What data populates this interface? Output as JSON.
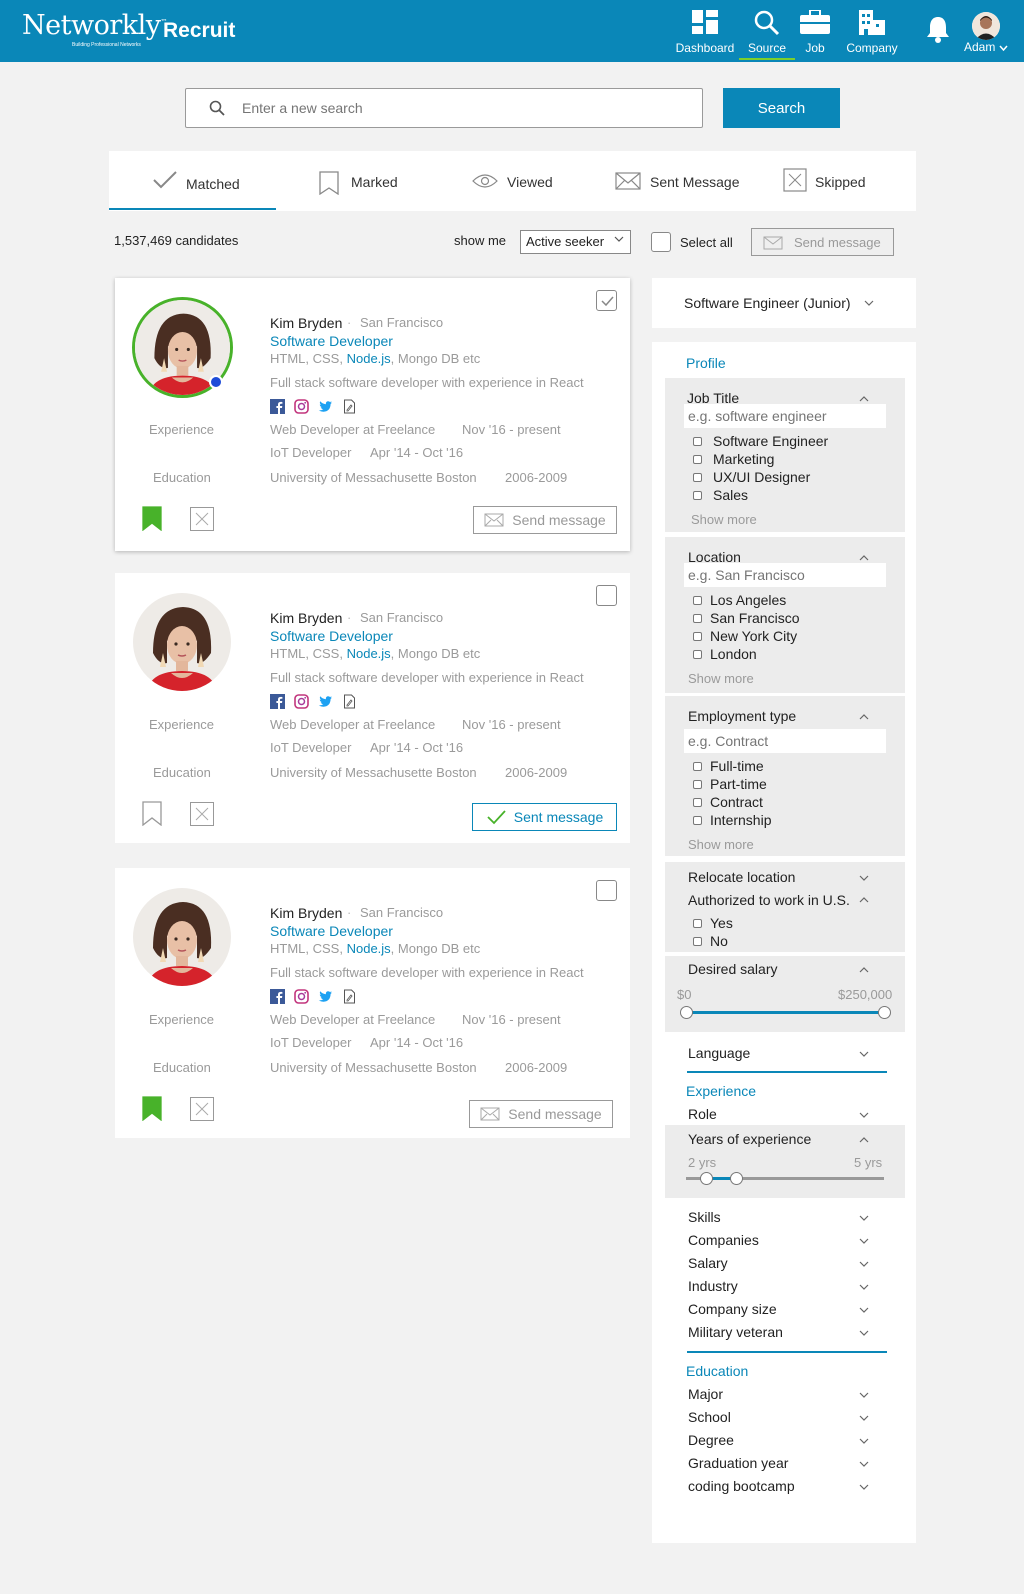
{
  "header": {
    "logo": "Networkly",
    "tm": "™",
    "tagline": "Building Professional Networks",
    "app": "Recruit",
    "nav": [
      "Dashboard",
      "Source",
      "Job",
      "Company"
    ],
    "active_nav": "Source",
    "user": "Adam"
  },
  "search": {
    "placeholder": "Enter a new search",
    "button": "Search"
  },
  "tabs": [
    "Matched",
    "Marked",
    "Viewed",
    "Sent Message",
    "Skipped"
  ],
  "toolbar": {
    "count": "1,537,469 candidates",
    "show_me": "show me",
    "filter_value": "Active seeker",
    "select_all": "Select all",
    "send_message": "Send message"
  },
  "candidates": [
    {
      "name": "Kim Bryden",
      "sep": "·",
      "city": "San Francisco",
      "role": "Software Developer",
      "skills_a": "HTML, CSS,",
      "skills_b": "Node.js",
      "skills_c": ", Mongo DB etc",
      "summary": "Full stack software developer with experience in React",
      "exp_label": "Experience",
      "exp1": "Web Developer at Freelance",
      "exp1_date": "Nov '16 - present",
      "exp2": "IoT Developer",
      "exp2_date": "Apr '14 - Oct '16",
      "edu_label": "Education",
      "edu": "University of Messachusette Boston",
      "edu_date": "2006-2009",
      "action": "Send message",
      "checked": true,
      "marked": true
    },
    {
      "name": "Kim Bryden",
      "sep": "·",
      "city": "San Francisco",
      "role": "Software Developer",
      "skills_a": "HTML, CSS,",
      "skills_b": "Node.js",
      "skills_c": ", Mongo DB etc",
      "summary": "Full stack software developer with experience in React",
      "exp_label": "Experience",
      "exp1": "Web Developer at Freelance",
      "exp1_date": "Nov '16 - present",
      "exp2": "IoT Developer",
      "exp2_date": "Apr '14 - Oct '16",
      "edu_label": "Education",
      "edu": "University of Messachusette Boston",
      "edu_date": "2006-2009",
      "action": "Sent message",
      "checked": false,
      "marked": false
    },
    {
      "name": "Kim Bryden",
      "sep": "·",
      "city": "San Francisco",
      "role": "Software Developer",
      "skills_a": "HTML, CSS,",
      "skills_b": "Node.js",
      "skills_c": ", Mongo DB etc",
      "summary": "Full stack software developer with experience in React",
      "exp_label": "Experience",
      "exp1": "Web Developer at Freelance",
      "exp1_date": "Nov '16 - present",
      "exp2": "IoT Developer",
      "exp2_date": "Apr '14 - Oct '16",
      "edu_label": "Education",
      "edu": "University of Messachusette Boston",
      "edu_date": "2006-2009",
      "action": "Send message",
      "checked": false,
      "marked": true
    }
  ],
  "sidebar": {
    "job": "Software Engineer (Junior)",
    "profile": "Profile",
    "job_title": {
      "label": "Job Title",
      "placeholder": "e.g. software engineer",
      "options": [
        "Software Engineer",
        "Marketing",
        "UX/UI Designer",
        "Sales"
      ],
      "more": "Show more"
    },
    "location": {
      "label": "Location",
      "placeholder": "e.g. San Francisco",
      "options": [
        "Los Angeles",
        "San Francisco",
        "New York City",
        "London"
      ],
      "more": "Show more"
    },
    "employment": {
      "label": "Employment type",
      "placeholder": "e.g. Contract",
      "options": [
        "Full-time",
        "Part-time",
        "Contract",
        "Internship"
      ],
      "more": "Show more"
    },
    "relocate": "Relocate location",
    "authorized": {
      "label": "Authorized to work in U.S.",
      "options": [
        "Yes",
        "No"
      ]
    },
    "salary": {
      "label": "Desired salary",
      "min": "$0",
      "max": "$250,000",
      "low": 0,
      "high": 1
    },
    "language": "Language",
    "experience": "Experience",
    "role": "Role",
    "years": {
      "label": "Years of experience",
      "min": "2 yrs",
      "max": "5 yrs",
      "low": 0.1,
      "high": 0.25
    },
    "more_filters": [
      "Skills",
      "Companies",
      "Salary",
      "Industry",
      "Company size",
      "Military veteran"
    ],
    "education": "Education",
    "edu_filters": [
      "Major",
      "School",
      "Degree",
      "Graduation year",
      "coding bootcamp"
    ]
  },
  "colors": {
    "brand": "#0a87b8",
    "accent": "#48b22a",
    "online": "#1d4bd8"
  }
}
